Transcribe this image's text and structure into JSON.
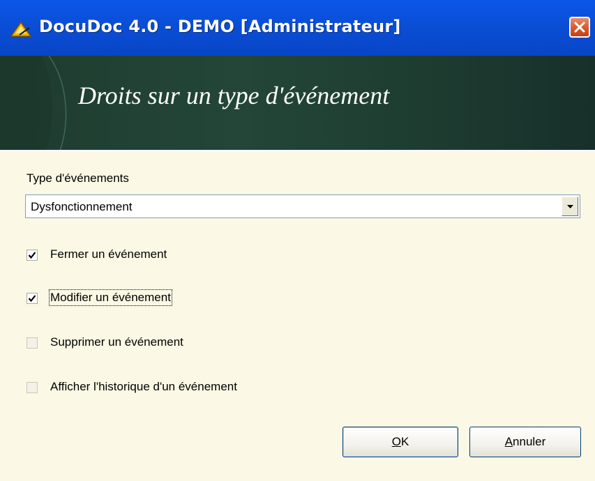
{
  "window": {
    "title": "DocuDoc 4.0 - DEMO [Administrateur]",
    "app_icon": "docudoc-logo-icon",
    "close_icon": "close-icon"
  },
  "banner": {
    "title": "Droits sur un type d'événement"
  },
  "event_type": {
    "label": "Type d'événements",
    "selected": "Dysfonctionnement",
    "arrow_icon": "chevron-down-icon"
  },
  "permissions": [
    {
      "label": "Fermer un événement",
      "checked": true
    },
    {
      "label": "Modifier un événement",
      "checked": true
    },
    {
      "label": "Supprimer un événement",
      "checked": false
    },
    {
      "label": "Afficher l'historique d'un événement",
      "checked": false
    }
  ],
  "buttons": {
    "ok_first": "O",
    "ok_rest": "K",
    "cancel_first": "A",
    "cancel_rest": "nnuler"
  },
  "colors": {
    "titlebar": "#0a4fd8",
    "banner": "#234638",
    "body": "#fbf8e5",
    "close": "#d65a2f"
  }
}
